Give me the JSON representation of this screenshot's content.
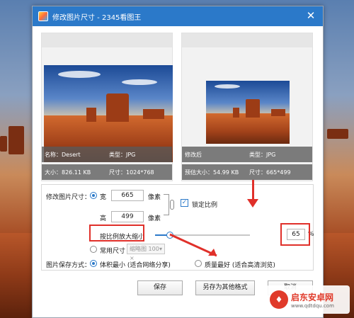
{
  "window": {
    "title": "修改图片尺寸 - 2345看图王"
  },
  "preview_left": {
    "name_label": "名称：Desert",
    "type_label": "类型：JPG",
    "size_label": "大小：826.11 KB",
    "dims_label": "尺寸：1024*768"
  },
  "preview_right": {
    "after_label": "修改后",
    "type_label": "类型：JPG",
    "size_label": "预估大小：54.99 KB",
    "dims_label": "尺寸：665*499"
  },
  "resize": {
    "section_label": "修改图片尺寸：",
    "width_label": "宽",
    "width_value": "665",
    "width_unit": "像素",
    "height_label": "高",
    "height_value": "499",
    "height_unit": "像素",
    "lock_ratio_label": "锁定比例",
    "lock_ratio_checked": true,
    "scale_label": "按比例放大缩小",
    "scale_value": "65",
    "scale_unit": "%",
    "scale_fraction": 0.65,
    "common_size_label": "常用尺寸",
    "common_size_select": "缩略图 100 ×"
  },
  "save_mode": {
    "section_label": "图片保存方式：",
    "option_small": "体积最小 (适合网络分享)",
    "option_best": "质量最好 (适合高清浏览)"
  },
  "buttons": {
    "save": "保存",
    "save_as": "另存为其他格式",
    "cancel": "取消"
  },
  "watermark": {
    "title": "启东安卓网",
    "url": "www.qdtdqu.com"
  },
  "colors": {
    "titlebar": "#2b79c9",
    "accent": "#2b79c9",
    "annotation": "#e0302a"
  }
}
